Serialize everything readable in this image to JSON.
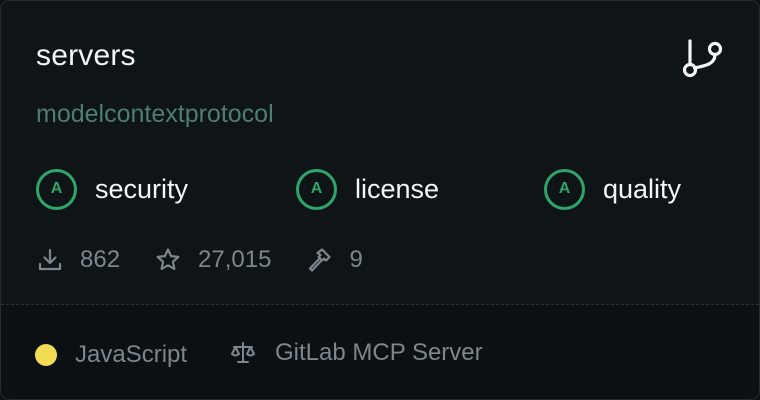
{
  "repo": {
    "name": "servers",
    "owner": "modelcontextprotocol"
  },
  "grades": [
    {
      "grade": "A",
      "label": "security"
    },
    {
      "grade": "A",
      "label": "license"
    },
    {
      "grade": "A",
      "label": "quality"
    }
  ],
  "stats": {
    "downloads": "862",
    "stars": "27,015",
    "tools": "9"
  },
  "footer": {
    "language": "JavaScript",
    "language_color": "#f0dc55",
    "license_text": "GitLab MCP Server"
  },
  "colors": {
    "grade_accent": "#2ea56a",
    "owner": "#4f7e71"
  },
  "icons": {
    "fork": "git-fork-icon",
    "download": "download-icon",
    "star": "star-icon",
    "tool": "hammer-icon",
    "license": "scale-icon"
  }
}
